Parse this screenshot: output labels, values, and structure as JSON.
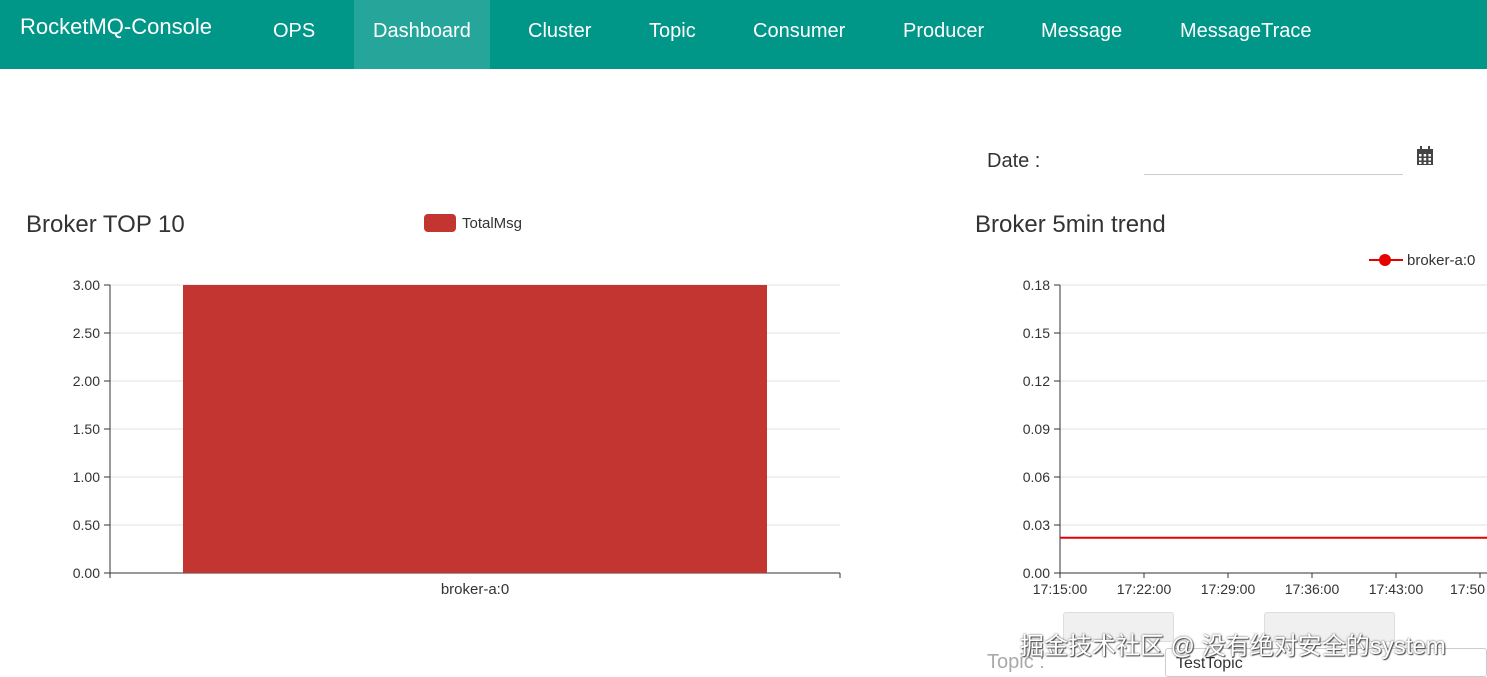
{
  "navbar": {
    "brand": "RocketMQ-Console",
    "items": [
      {
        "label": "OPS",
        "active": false
      },
      {
        "label": "Dashboard",
        "active": true
      },
      {
        "label": "Cluster",
        "active": false
      },
      {
        "label": "Topic",
        "active": false
      },
      {
        "label": "Consumer",
        "active": false
      },
      {
        "label": "Producer",
        "active": false
      },
      {
        "label": "Message",
        "active": false
      },
      {
        "label": "MessageTrace",
        "active": false
      }
    ]
  },
  "filters": {
    "date_label": "Date :",
    "date_value": "",
    "topic_label": "Topic :",
    "topic_value": "TestTopic"
  },
  "colors": {
    "navbar": "#009688",
    "navbar_active": "#26a69a",
    "bar": "#c23531",
    "line": "#e60000"
  },
  "icons": {
    "calendar": "calendar-icon"
  },
  "watermark": "掘金技术社区 @ 没有绝对安全的system",
  "chart_data": [
    {
      "type": "bar",
      "title": "Broker TOP 10",
      "legend": [
        "TotalMsg"
      ],
      "categories": [
        "broker-a:0"
      ],
      "series": [
        {
          "name": "TotalMsg",
          "values": [
            3
          ]
        }
      ],
      "yticks": [
        "3.00",
        "2.50",
        "2.00",
        "1.50",
        "1.00",
        "0.50",
        "0.00"
      ],
      "ylim": [
        0,
        3
      ],
      "grid": true,
      "legend_position": "top"
    },
    {
      "type": "line",
      "title": "Broker 5min trend",
      "legend": [
        "broker-a:0"
      ],
      "x": [
        "17:15:00",
        "17:22:00",
        "17:29:00",
        "17:36:00",
        "17:43:00",
        "17:50"
      ],
      "series": [
        {
          "name": "broker-a:0",
          "values": [
            0.022,
            0.022,
            0.022,
            0.022,
            0.022,
            0.022
          ]
        }
      ],
      "yticks": [
        "0.18",
        "0.15",
        "0.12",
        "0.09",
        "0.06",
        "0.03",
        "0.00"
      ],
      "ylim": [
        0,
        0.18
      ],
      "grid": true,
      "legend_position": "top-right"
    }
  ]
}
